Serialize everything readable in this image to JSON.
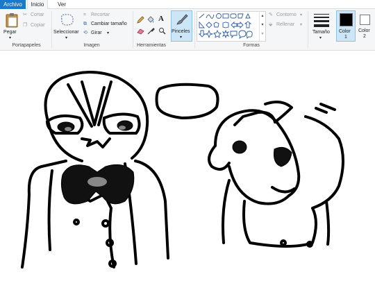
{
  "tabs": {
    "file": "Archivo",
    "home": "Inicio",
    "view": "Ver"
  },
  "clipboard": {
    "paste": "Pegar",
    "cut": "Cortar",
    "copy": "Copiar",
    "label": "Portapapeles"
  },
  "image": {
    "select": "Seleccionar",
    "crop": "Recortar",
    "resize": "Cambiar tamaño",
    "rotate": "Girar",
    "label": "Imagen"
  },
  "tools": {
    "label": "Herramientas",
    "text_glyph": "A"
  },
  "brushes": {
    "label": "Pinceles"
  },
  "shapes": {
    "label": "Formas",
    "outline": "Contorno",
    "fill": "Rellenar"
  },
  "size": {
    "label": "Tamaño"
  },
  "colors": {
    "color1": "Color",
    "color1_num": "1",
    "color2": "Color",
    "color2_num": "2",
    "color1_hex": "#000000",
    "color2_hex": "#ffffff"
  },
  "accent": "#1979ca"
}
